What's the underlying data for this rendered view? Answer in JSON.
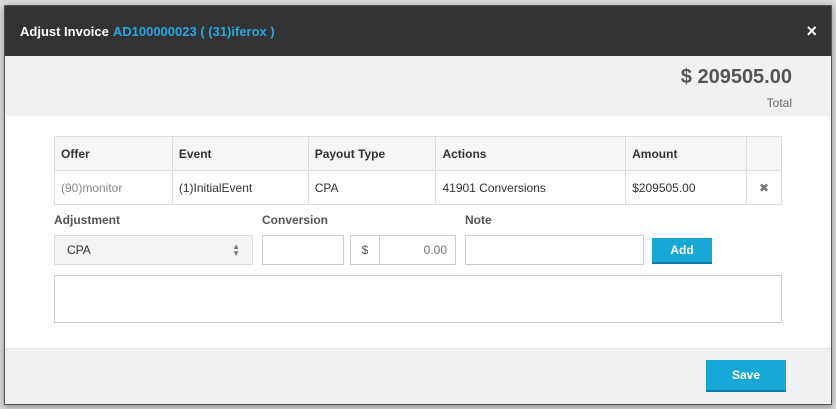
{
  "header": {
    "title": "Adjust Invoice",
    "invoice_ref": "AD100000023 ( (31)iferox )",
    "close_icon": "×"
  },
  "total": {
    "amount": "$ 209505.00",
    "label": "Total"
  },
  "table": {
    "columns": [
      "Offer",
      "Event",
      "Payout Type",
      "Actions",
      "Amount",
      ""
    ],
    "rows": [
      {
        "offer": "(90)monitor",
        "event": "(1)InitialEvent",
        "payout_type": "CPA",
        "actions": "41901 Conversions",
        "amount": "$209505.00",
        "remove_icon": "✖"
      }
    ]
  },
  "form": {
    "adjustment_label": "Adjustment",
    "adjustment_value": "CPA",
    "conversion_label": "Conversion",
    "conversion_value": "",
    "currency_symbol": "$",
    "amount_placeholder": "0.00",
    "note_label": "Note",
    "note_value": "",
    "add_button": "Add"
  },
  "footer": {
    "save_button": "Save"
  },
  "colors": {
    "header_bg": "#333333",
    "link": "#29a8dc",
    "button": "#18a8d8"
  }
}
